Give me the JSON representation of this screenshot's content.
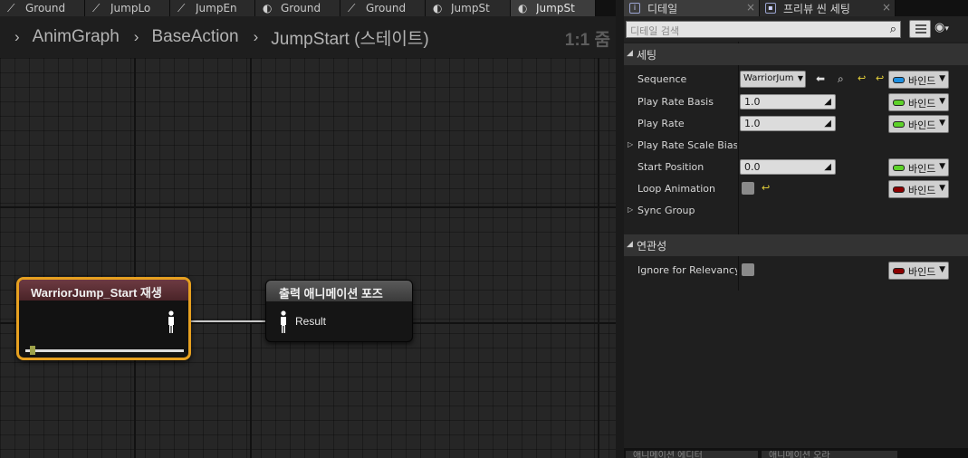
{
  "graph": {
    "tabs": [
      {
        "label": "Ground",
        "icon": "transition-icon"
      },
      {
        "label": "JumpLo",
        "icon": "transition-icon"
      },
      {
        "label": "JumpEn",
        "icon": "transition-icon"
      },
      {
        "label": "Ground",
        "icon": "state-icon"
      },
      {
        "label": "Ground",
        "icon": "transition-icon"
      },
      {
        "label": "JumpSt",
        "icon": "state-icon"
      },
      {
        "label": "JumpSt",
        "icon": "state-icon"
      }
    ],
    "breadcrumb": [
      "AnimGraph",
      "BaseAction",
      "JumpStart (스테이트)"
    ],
    "zoom": "1:1 줌",
    "play_node": {
      "title": "WarriorJump_Start 재생",
      "progress": 0.03
    },
    "result_node": {
      "title": "출력 애니메이션 포즈",
      "pin_label": "Result"
    }
  },
  "details": {
    "tabs": [
      {
        "label": "디테일",
        "active": true
      },
      {
        "label": "프리뷰 씬 세팅",
        "active": false
      }
    ],
    "search_placeholder": "디테일 검색",
    "categories": {
      "settings": "세팅",
      "relevancy": "연관성"
    },
    "bind_label": "바인드",
    "properties": {
      "sequence": {
        "label": "Sequence",
        "value": "WarriorJum"
      },
      "play_rate_basis": {
        "label": "Play Rate Basis",
        "value": "1.0"
      },
      "play_rate": {
        "label": "Play Rate",
        "value": "1.0"
      },
      "play_rate_scale_bias": {
        "label": "Play Rate Scale Bias C"
      },
      "start_position": {
        "label": "Start Position",
        "value": "0.0"
      },
      "loop_animation": {
        "label": "Loop Animation",
        "checked": false
      },
      "sync_group": {
        "label": "Sync Group"
      },
      "ignore_relevancy": {
        "label": "Ignore for Relevancy T",
        "checked": false
      }
    },
    "bind_colors": {
      "sequence": "#1e8fe0",
      "float": "#5ed22a",
      "bool": "#8b0000"
    },
    "bottom_tabs": [
      "애니메이션 에디터",
      "애니메이션 오라"
    ]
  }
}
